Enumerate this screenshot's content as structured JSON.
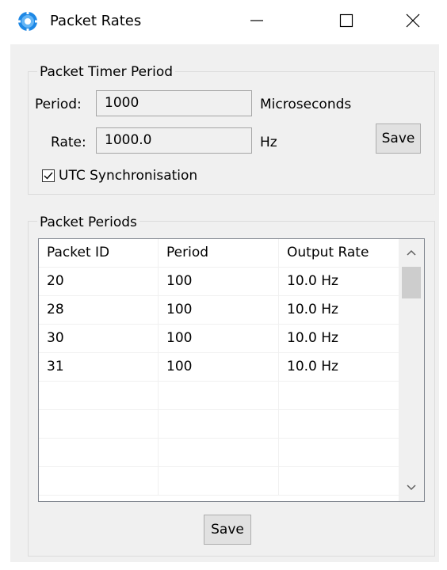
{
  "window": {
    "title": "Packet Rates",
    "icon": "gear-globe-icon",
    "controls": {
      "minimize": "minimize-icon",
      "maximize": "maximize-icon",
      "close": "close-icon"
    }
  },
  "timer_group": {
    "title": "Packet Timer Period",
    "period_label": "Period:",
    "period_value": "1000",
    "period_unit": "Microseconds",
    "rate_label": "Rate:",
    "rate_value": "1000.0",
    "rate_unit": "Hz",
    "save_label": "Save",
    "utc_label": "UTC Synchronisation",
    "utc_checked": true
  },
  "periods_group": {
    "title": "Packet Periods",
    "columns": [
      "Packet ID",
      "Period",
      "Output Rate"
    ],
    "rows": [
      [
        "20",
        "100",
        "10.0 Hz"
      ],
      [
        "28",
        "100",
        "10.0 Hz"
      ],
      [
        "30",
        "100",
        "10.0 Hz"
      ],
      [
        "31",
        "100",
        "10.0 Hz"
      ]
    ],
    "save_label": "Save"
  },
  "colors": {
    "window_bg": "#ffffff",
    "client_bg": "#f0f0f0",
    "icon_blue": "#1e88e5",
    "button_bg": "#e1e1e1",
    "scroll_thumb": "#cdcdcd"
  }
}
